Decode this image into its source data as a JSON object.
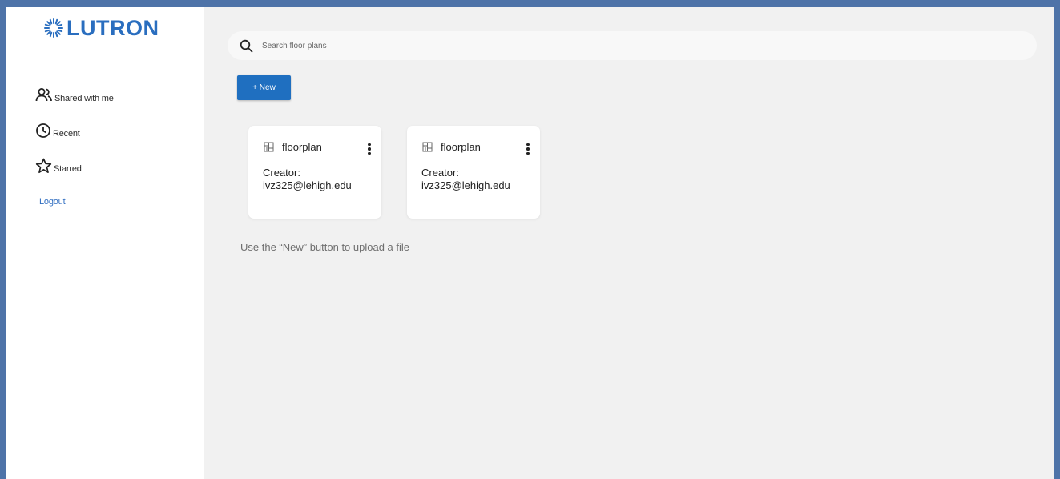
{
  "brand": {
    "logo_text": "LUTRON",
    "color": "#2a6ebf"
  },
  "sidebar": {
    "items": [
      {
        "label": "Shared with me",
        "icon": "users-icon"
      },
      {
        "label": "Recent",
        "icon": "clock-icon"
      },
      {
        "label": "Starred",
        "icon": "star-icon"
      }
    ],
    "logout_label": "Logout"
  },
  "search": {
    "placeholder": "Search floor plans",
    "value": ""
  },
  "toolbar": {
    "new_label": "+ New",
    "accent": "#1f6fc0"
  },
  "cards": [
    {
      "icon": "floorplan-icon",
      "title": "floorplan",
      "creator_label": "Creator:",
      "creator": "ivz325@lehigh.edu"
    },
    {
      "icon": "floorplan-icon",
      "title": "floorplan",
      "creator_label": "Creator:",
      "creator": "ivz325@lehigh.edu"
    }
  ],
  "hint": "Use the “New” button to upload a file"
}
